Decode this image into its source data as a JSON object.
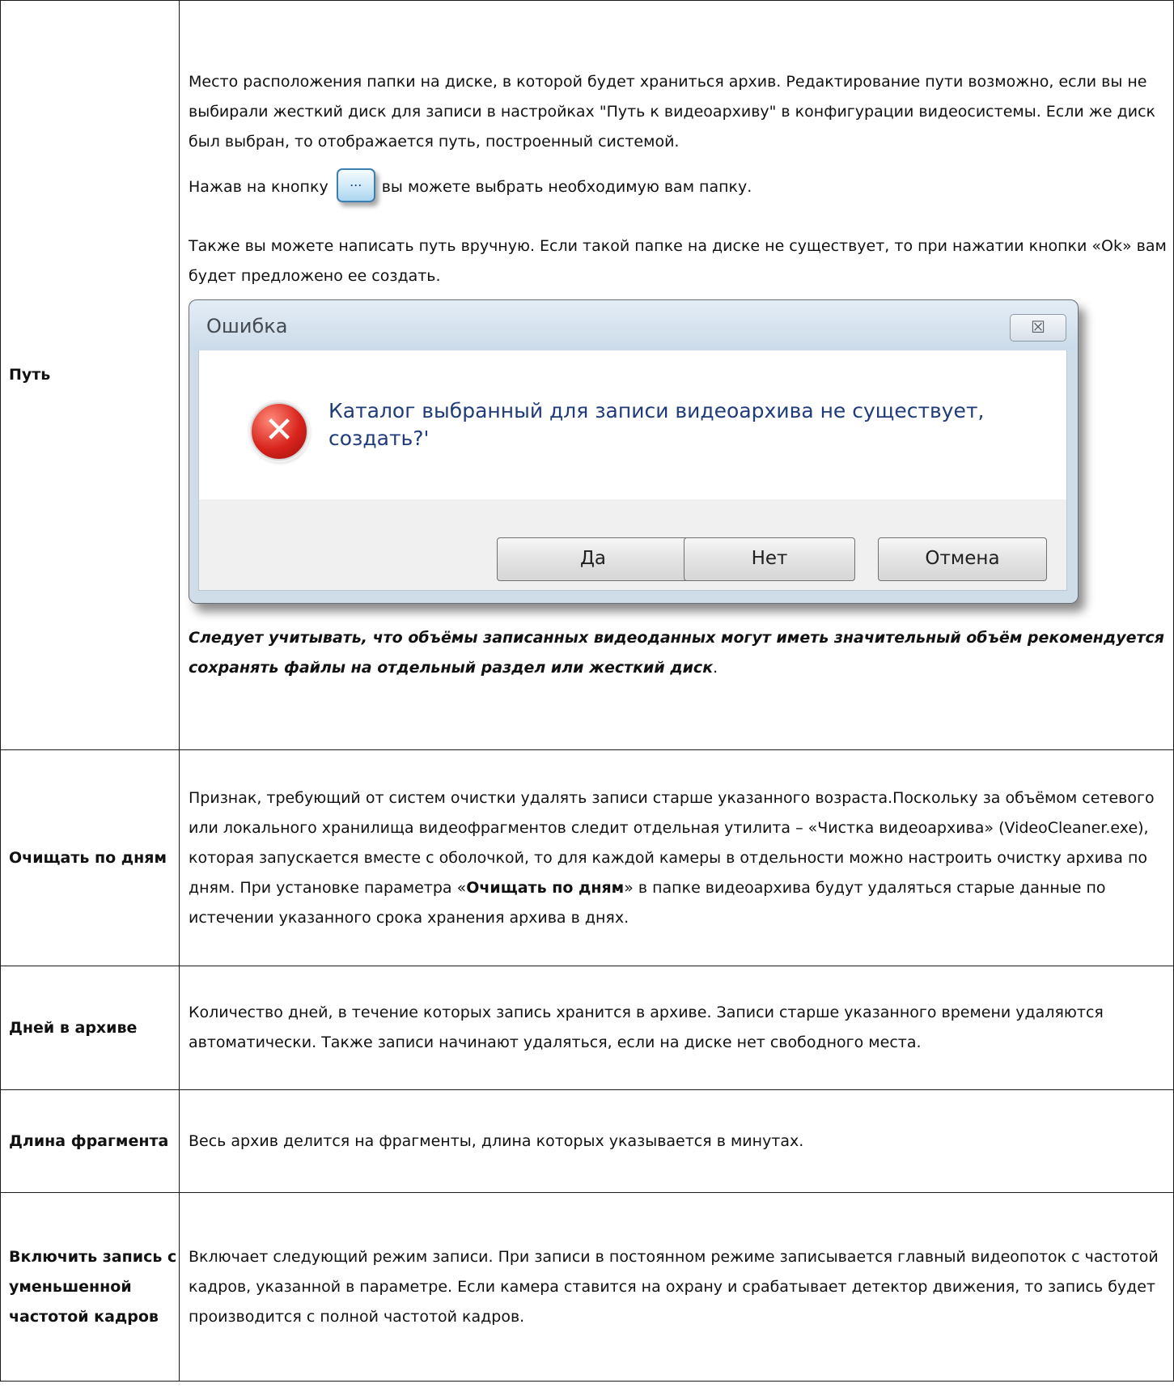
{
  "rows": [
    {
      "term": "Путь",
      "desc": {
        "p1": "Место расположения папки на диске, в которой будет храниться архив. Редактирование пути возможно, если вы не выбирали жесткий диск для записи в настройках \"Путь к видеоархиву\" в конфигурации видеосистемы. Если же диск был выбран, то отображается путь, построенный системой.",
        "p2_before": "Нажав на кнопку",
        "p2_button": "...",
        "p2_after": "вы можете выбрать необходимую вам папку.",
        "p3": "Также вы можете написать путь вручную. Если такой папке на диске не существует, то при нажатии кнопки «Ok» вам будет предложено ее создать.",
        "dialog": {
          "title": "Ошибка",
          "close": "☒",
          "message": "Каталог выбранный для записи видеоархива не существует, создать?'",
          "buttons": [
            "Да",
            "Нет",
            "Отмена"
          ]
        },
        "note": "Следует учитывать, что объёмы записанных видеоданных могут иметь значительный объём рекомендуется сохранять файлы на отдельный раздел или жесткий диск",
        "note_end": "."
      }
    },
    {
      "term": "Очищать по дням",
      "desc_before": "Признак, требующий от систем очистки удалять записи старше указанного возраста.Поскольку за объёмом сетевого или локального хранилища видеофрагментов следит отдельная утилита – «Чистка видеоархива» (VideoCleaner.exe), которая запускается вместе с оболочкой, то для каждой камеры в отдельности можно настроить очистку архива по дням. При установке параметра «",
      "desc_bold": "Очищать по дням",
      "desc_after": "» в папке видеоархива будут удаляться старые данные по истечении указанного срока хранения архива в днях."
    },
    {
      "term": "Дней в архиве",
      "desc": "Количество дней, в течение которых запись хранится в архиве. Записи старше указанного времени удаляются автоматически. Также записи начинают удаляться, если на диске нет свободного места."
    },
    {
      "term": "Длина фрагмента",
      "desc": "Весь архив делится на фрагменты, длина которых указывается в минутах."
    },
    {
      "term": "Включить запись с уменьшенной частотой кадров",
      "desc": "Включает следующий режим записи. При записи в постоянном режиме записывается главный видеопоток с частотой кадров, указанной в параметре. Если камера ставится на охрану и срабатывает детектор движения, то запись будет производится с полной частотой кадров."
    }
  ]
}
